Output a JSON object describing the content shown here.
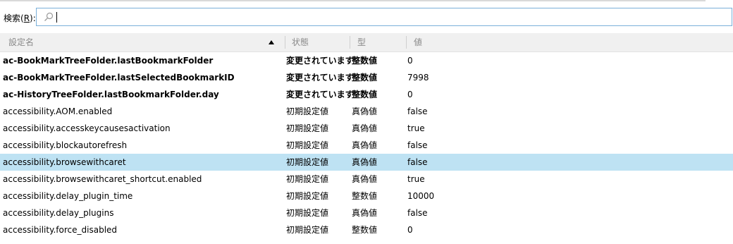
{
  "search": {
    "label": "検索(",
    "accel": "R",
    "label_end": "):",
    "value": ""
  },
  "columns": {
    "name": "設定名",
    "status": "状態",
    "type": "型",
    "value": "値"
  },
  "rows": [
    {
      "name": "ac-BookMarkTreeFolder.lastBookmarkFolder",
      "status": "変更されています",
      "type": "整数値",
      "value": "0",
      "modified": true
    },
    {
      "name": "ac-BookMarkTreeFolder.lastSelectedBookmarkID",
      "status": "変更されています",
      "type": "整数値",
      "value": "7998",
      "modified": true
    },
    {
      "name": "ac-HistoryTreeFolder.lastBookmarkFolder.day",
      "status": "変更されています",
      "type": "整数値",
      "value": "0",
      "modified": true
    },
    {
      "name": "accessibility.AOM.enabled",
      "status": "初期設定値",
      "type": "真偽値",
      "value": "false",
      "modified": false
    },
    {
      "name": "accessibility.accesskeycausesactivation",
      "status": "初期設定値",
      "type": "真偽値",
      "value": "true",
      "modified": false
    },
    {
      "name": "accessibility.blockautorefresh",
      "status": "初期設定値",
      "type": "真偽値",
      "value": "false",
      "modified": false
    },
    {
      "name": "accessibility.browsewithcaret",
      "status": "初期設定値",
      "type": "真偽値",
      "value": "false",
      "modified": false,
      "selected": true
    },
    {
      "name": "accessibility.browsewithcaret_shortcut.enabled",
      "status": "初期設定値",
      "type": "真偽値",
      "value": "true",
      "modified": false
    },
    {
      "name": "accessibility.delay_plugin_time",
      "status": "初期設定値",
      "type": "整数値",
      "value": "10000",
      "modified": false
    },
    {
      "name": "accessibility.delay_plugins",
      "status": "初期設定値",
      "type": "真偽値",
      "value": "false",
      "modified": false
    },
    {
      "name": "accessibility.force_disabled",
      "status": "初期設定値",
      "type": "整数値",
      "value": "0",
      "modified": false
    }
  ],
  "colors": {
    "selected_row": "#bee2f3",
    "search_border": "#7ab0da",
    "header_bg": "#f0f0f0"
  }
}
